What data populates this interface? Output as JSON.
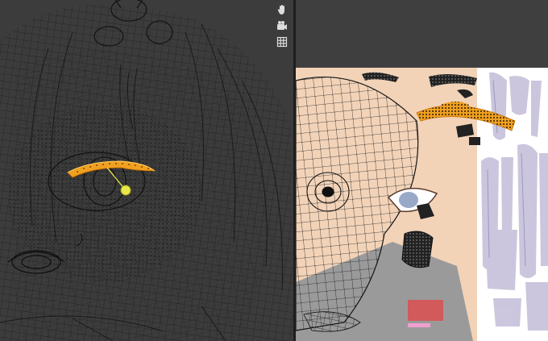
{
  "viewport_3d": {
    "mode": "wireframe-edit",
    "background": "#3c3c3c",
    "wire_color": "#1a1a1a",
    "selection_color": "#f0a020",
    "active_vertex_color": "#e8e84a",
    "gizmo": {
      "pan_icon": "hand-icon",
      "camera_icon": "camera-icon",
      "ortho_icon": "grid-icon"
    }
  },
  "uv_editor": {
    "background": "#3f3f3f",
    "texture_colors": {
      "skin": "#f2d3b8",
      "hair": "#c9c4dc",
      "white": "#ffffff",
      "gray": "#9a9a9a",
      "mouth_swatch": "#d25a5a",
      "pink_stripe": "#f0a0d0"
    }
  }
}
